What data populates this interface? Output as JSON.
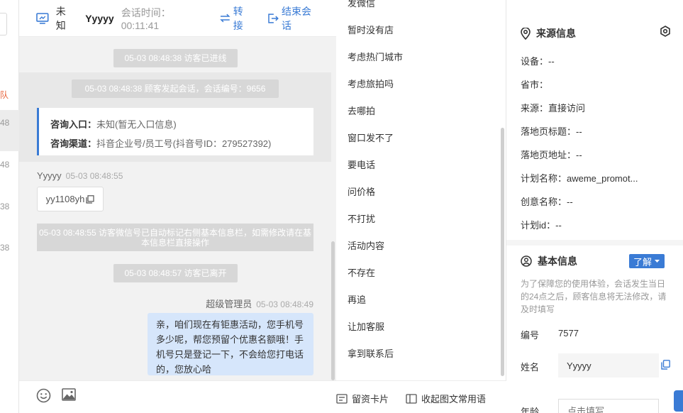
{
  "left_strip": {
    "red_text": "队",
    "times": [
      "48",
      "48",
      "38",
      "38"
    ]
  },
  "header": {
    "status": "未知",
    "visitor_name": "Yyyyy",
    "session_time": "会话时间：00:11:41",
    "transfer": "转接",
    "end_session": "结束会话"
  },
  "messages": {
    "sys_enter": "05-03 08:48:38 访客已进线",
    "sys_start": "05-03 08:48:38 顾客发起会话，会话编号：9656",
    "card": {
      "entry_label": "咨询入口：",
      "entry_value": "未知(暂无入口信息)",
      "channel_label": "咨询渠道：",
      "channel_value": "抖音企业号/员工号(抖音号ID：279527392)"
    },
    "visitor": "Yyyyy",
    "visitor_time": "05-03 08:48:55",
    "wechat_id": "yy1108yh",
    "sys_wechat": "05-03 08:48:55 访客微信号已自动标记右侧基本信息栏，如需修改请在基本信息栏直接操作",
    "sys_leave": "05-03 08:48:57 访客已离开",
    "agent": "超级管理员",
    "agent_time": "05-03 08:48:49",
    "agent_msg": "亲，咱们现在有钜惠活动，您手机号多少呢，帮您预留个优惠名额哦！手机号只是登记一下，不会给您打电话的，您放心哈"
  },
  "phrases": {
    "items": [
      "发微信",
      "暂时没有店",
      "考虑热门城市",
      "考虑旅拍吗",
      "去哪拍",
      "窗口发不了",
      "要电话",
      "问价格",
      "不打扰",
      "活动内容",
      "不存在",
      "再追",
      "让加客服",
      "拿到联系后"
    ],
    "card_btn": "留资卡片",
    "collapse_btn": "收起图文常用语"
  },
  "source": {
    "title": "来源信息",
    "device": "设备：--",
    "province": "省市：",
    "origin": "来源：直接访问",
    "landing_title": "落地页标题：--",
    "landing_url": "落地页地址：--",
    "plan_name": "计划名称：aweme_promot...",
    "creative_name": "创意名称：--",
    "plan_id": "计划id：--"
  },
  "basic": {
    "title": "基本信息",
    "know_btn": "了解",
    "note": "为了保障您的使用体验，会话发生当日的24点之后，顾客信息将无法修改，请及时填写",
    "id_label": "编号",
    "id_value": "7577",
    "name_label": "姓名",
    "name_value": "Yyyyy",
    "age_label": "年龄",
    "age_placeholder": "点击填写"
  },
  "colors": {
    "accent": "#3a7bd5",
    "bubble": "#d6e6fb",
    "system_pill": "#d7d7d7"
  }
}
